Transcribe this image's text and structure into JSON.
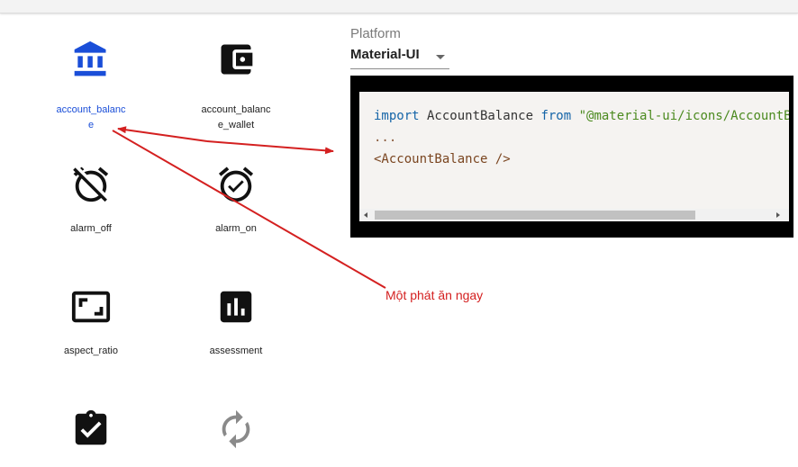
{
  "icons": [
    {
      "label": "account_balance",
      "selected": true,
      "icon": "account-balance-icon"
    },
    {
      "label": "account_balance_wallet",
      "selected": false,
      "icon": "account-balance-wallet-icon"
    },
    {
      "label": "alarm_off",
      "selected": false,
      "icon": "alarm-off-icon"
    },
    {
      "label": "alarm_on",
      "selected": false,
      "icon": "alarm-on-icon"
    },
    {
      "label": "aspect_ratio",
      "selected": false,
      "icon": "aspect-ratio-icon"
    },
    {
      "label": "assessment",
      "selected": false,
      "icon": "assessment-icon"
    },
    {
      "label": "",
      "selected": false,
      "icon": "assignment-turned-in-icon"
    },
    {
      "label": "",
      "selected": false,
      "icon": "autorenew-icon"
    }
  ],
  "platform": {
    "label": "Platform",
    "value": "Material-UI"
  },
  "code": {
    "import_kw": "import",
    "component": " AccountBalance ",
    "from_kw": "from",
    "path": " \"@material-ui/icons/AccountBalance\";",
    "ellipsis": "...",
    "usage": "<AccountBalance />"
  },
  "annotation": {
    "text": "Một phát ăn ngay",
    "color": "#d42020"
  },
  "colors": {
    "selected": "#1a4ed8",
    "icon": "#111111",
    "refresh_icon": "#8a8a8a"
  }
}
